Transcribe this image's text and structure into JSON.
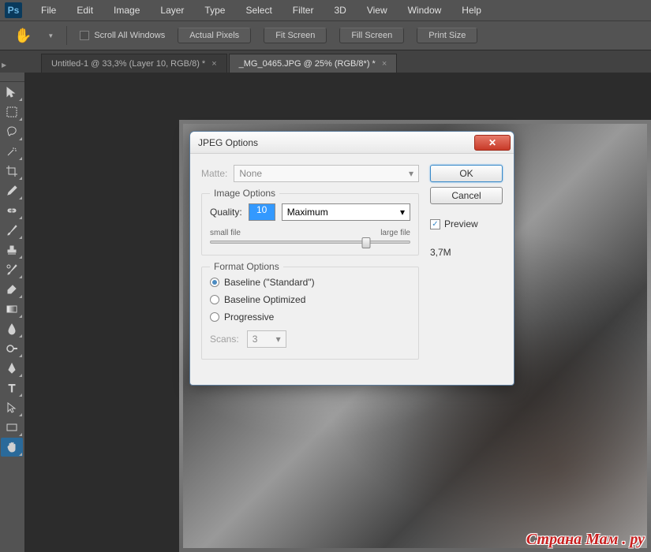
{
  "app": {
    "logo": "Ps"
  },
  "menubar": [
    "File",
    "Edit",
    "Image",
    "Layer",
    "Type",
    "Select",
    "Filter",
    "3D",
    "View",
    "Window",
    "Help"
  ],
  "optionsbar": {
    "scroll_all": "Scroll All Windows",
    "buttons": [
      "Actual Pixels",
      "Fit Screen",
      "Fill Screen",
      "Print Size"
    ]
  },
  "tabs": [
    {
      "label": "Untitled-1 @ 33,3% (Layer 10, RGB/8) *",
      "active": false
    },
    {
      "label": "_MG_0465.JPG @ 25% (RGB/8*) *",
      "active": true
    }
  ],
  "dialog": {
    "title": "JPEG Options",
    "matte_label": "Matte:",
    "matte_value": "None",
    "image_options": {
      "legend": "Image Options",
      "quality_label": "Quality:",
      "quality_value": "10",
      "quality_level": "Maximum",
      "small_file": "small file",
      "large_file": "large file"
    },
    "format_options": {
      "legend": "Format Options",
      "options": [
        "Baseline (\"Standard\")",
        "Baseline Optimized",
        "Progressive"
      ],
      "selected": 0,
      "scans_label": "Scans:",
      "scans_value": "3"
    },
    "ok": "OK",
    "cancel": "Cancel",
    "preview": "Preview",
    "filesize": "3,7M"
  },
  "watermark": "Страна Мам . ру"
}
